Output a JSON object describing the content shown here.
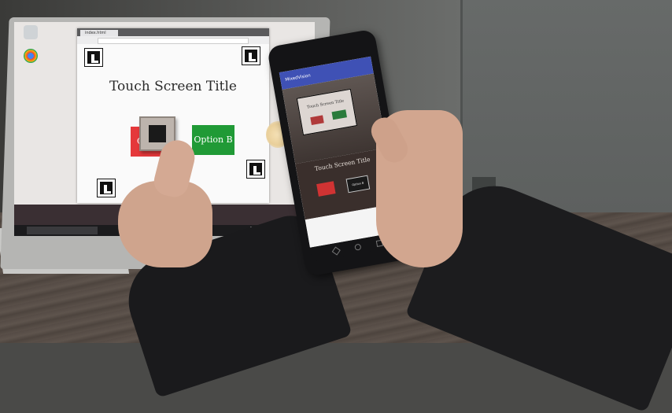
{
  "laptop": {
    "browser_tab_title": "index.html",
    "page_title": "Touch Screen Title",
    "option_a_label": "Optio",
    "option_b_label": "Option B"
  },
  "phone": {
    "app_title": "MixedVision",
    "camera_page_title": "Touch Screen Title",
    "overlay_title": "Touch Screen Title",
    "overlay_option_b": "Option B"
  },
  "colors": {
    "option_a": "#e5383b",
    "option_b": "#209a36",
    "app_bar": "#3f51b5"
  }
}
